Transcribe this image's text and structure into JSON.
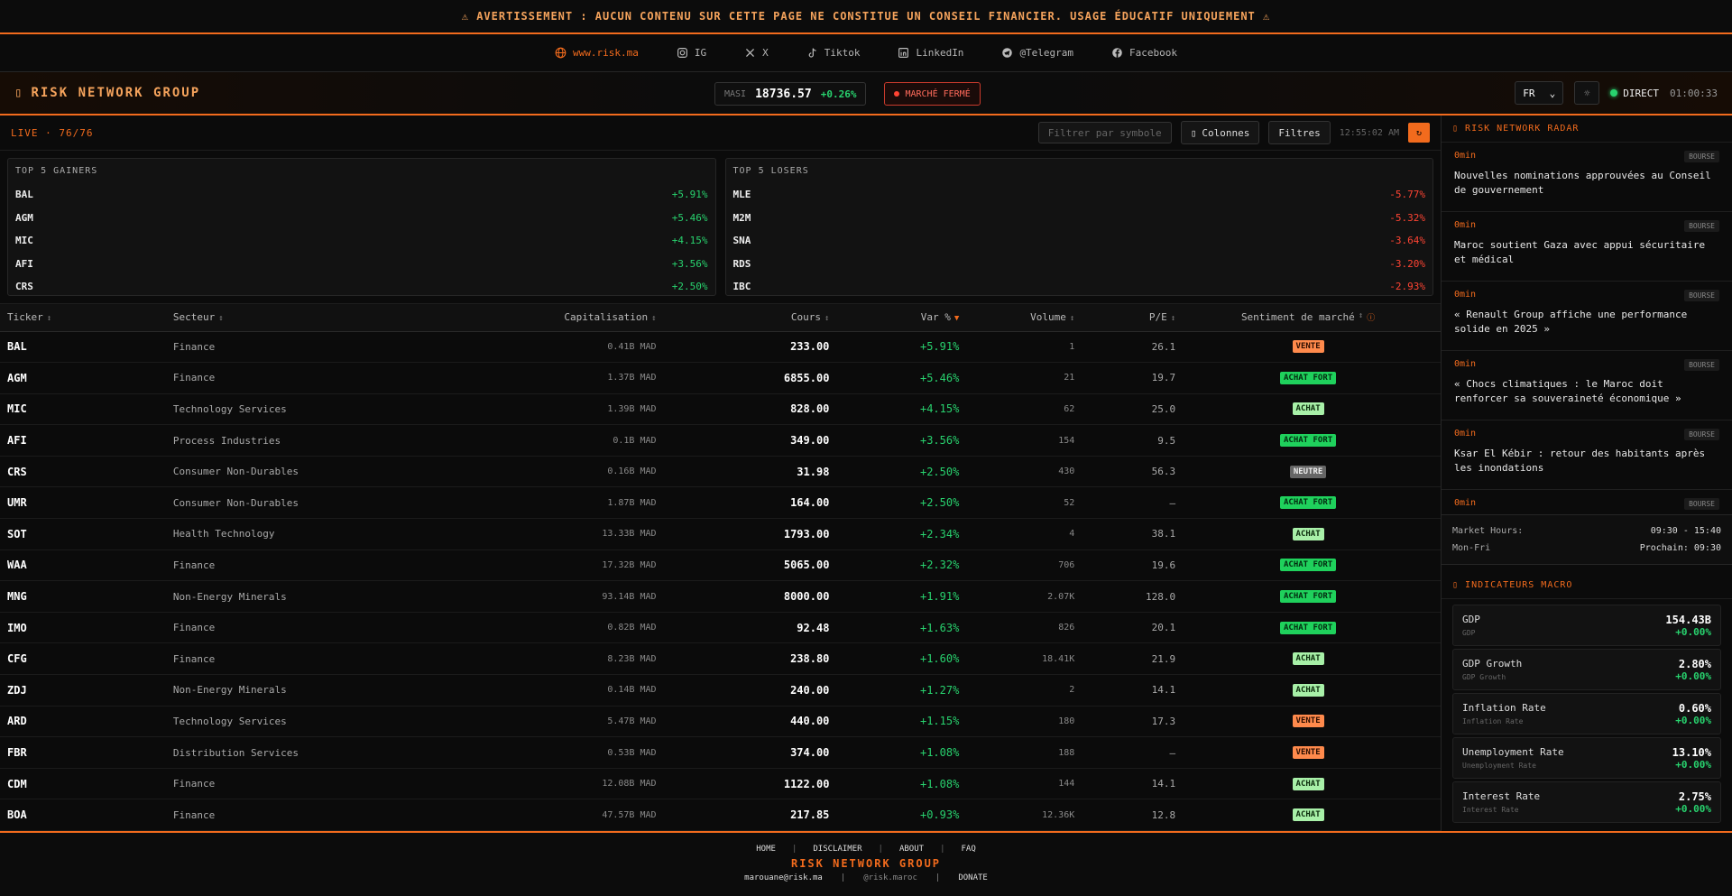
{
  "banner": {
    "text": "⚠ AVERTISSEMENT : AUCUN CONTENU SUR CETTE PAGE NE CONSTITUE UN CONSEIL FINANCIER. USAGE ÉDUCATIF UNIQUEMENT ⚠"
  },
  "social": [
    {
      "label": "www.risk.ma",
      "icon": "globe-icon"
    },
    {
      "label": "IG",
      "icon": "instagram-icon"
    },
    {
      "label": "X",
      "icon": "x-icon"
    },
    {
      "label": "Tiktok",
      "icon": "tiktok-icon"
    },
    {
      "label": "LinkedIn",
      "icon": "linkedin-icon"
    },
    {
      "label": "@Telegram",
      "icon": "telegram-icon"
    },
    {
      "label": "Facebook",
      "icon": "facebook-icon"
    }
  ],
  "header": {
    "brand": "RISK NETWORK GROUP",
    "masi_label": "MASI",
    "masi_value": "18736.57",
    "masi_change": "+0.26%",
    "market_status": "MARCHÉ FERMÉ",
    "language": "FR",
    "live_label": "DIRECT",
    "clock": "01:00:33"
  },
  "toolbar": {
    "live_count": "LIVE · 76/76",
    "filter_placeholder": "Filtrer par symbole",
    "columns_label": "Colonnes",
    "filters_label": "Filtres",
    "time": "12:55:02 AM"
  },
  "gainers": {
    "title": "TOP 5 GAINERS",
    "items": [
      {
        "symbol": "BAL",
        "change": "+5.91%"
      },
      {
        "symbol": "AGM",
        "change": "+5.46%"
      },
      {
        "symbol": "MIC",
        "change": "+4.15%"
      },
      {
        "symbol": "AFI",
        "change": "+3.56%"
      },
      {
        "symbol": "CRS",
        "change": "+2.50%"
      }
    ]
  },
  "losers": {
    "title": "TOP 5 LOSERS",
    "items": [
      {
        "symbol": "MLE",
        "change": "-5.77%"
      },
      {
        "symbol": "M2M",
        "change": "-5.32%"
      },
      {
        "symbol": "SNA",
        "change": "-3.64%"
      },
      {
        "symbol": "RDS",
        "change": "-3.20%"
      },
      {
        "symbol": "IBC",
        "change": "-2.93%"
      }
    ]
  },
  "table": {
    "headers": [
      "Ticker",
      "Secteur",
      "Capitalisation",
      "Cours",
      "Var %",
      "Volume",
      "P/E",
      "Sentiment de marché"
    ],
    "rows": [
      {
        "ticker": "BAL",
        "sector": "Finance",
        "cap": "0.41B MAD",
        "price": "233.00",
        "var": "+5.91%",
        "volume": "1",
        "pe": "26.1",
        "sentiment": "VENTE",
        "s": "vente"
      },
      {
        "ticker": "AGM",
        "sector": "Finance",
        "cap": "1.37B MAD",
        "price": "6855.00",
        "var": "+5.46%",
        "volume": "21",
        "pe": "19.7",
        "sentiment": "ACHAT FORT",
        "s": "achatfort"
      },
      {
        "ticker": "MIC",
        "sector": "Technology Services",
        "cap": "1.39B MAD",
        "price": "828.00",
        "var": "+4.15%",
        "volume": "62",
        "pe": "25.0",
        "sentiment": "ACHAT",
        "s": "achat"
      },
      {
        "ticker": "AFI",
        "sector": "Process Industries",
        "cap": "0.1B MAD",
        "price": "349.00",
        "var": "+3.56%",
        "volume": "154",
        "pe": "9.5",
        "sentiment": "ACHAT FORT",
        "s": "achatfort"
      },
      {
        "ticker": "CRS",
        "sector": "Consumer Non-Durables",
        "cap": "0.16B MAD",
        "price": "31.98",
        "var": "+2.50%",
        "volume": "430",
        "pe": "56.3",
        "sentiment": "NEUTRE",
        "s": "neutre"
      },
      {
        "ticker": "UMR",
        "sector": "Consumer Non-Durables",
        "cap": "1.87B MAD",
        "price": "164.00",
        "var": "+2.50%",
        "volume": "52",
        "pe": "—",
        "sentiment": "ACHAT FORT",
        "s": "achatfort"
      },
      {
        "ticker": "SOT",
        "sector": "Health Technology",
        "cap": "13.33B MAD",
        "price": "1793.00",
        "var": "+2.34%",
        "volume": "4",
        "pe": "38.1",
        "sentiment": "ACHAT",
        "s": "achat"
      },
      {
        "ticker": "WAA",
        "sector": "Finance",
        "cap": "17.32B MAD",
        "price": "5065.00",
        "var": "+2.32%",
        "volume": "706",
        "pe": "19.6",
        "sentiment": "ACHAT FORT",
        "s": "achatfort"
      },
      {
        "ticker": "MNG",
        "sector": "Non-Energy Minerals",
        "cap": "93.14B MAD",
        "price": "8000.00",
        "var": "+1.91%",
        "volume": "2.07K",
        "pe": "128.0",
        "sentiment": "ACHAT FORT",
        "s": "achatfort"
      },
      {
        "ticker": "IMO",
        "sector": "Finance",
        "cap": "0.82B MAD",
        "price": "92.48",
        "var": "+1.63%",
        "volume": "826",
        "pe": "20.1",
        "sentiment": "ACHAT FORT",
        "s": "achatfort"
      },
      {
        "ticker": "CFG",
        "sector": "Finance",
        "cap": "8.23B MAD",
        "price": "238.80",
        "var": "+1.60%",
        "volume": "18.41K",
        "pe": "21.9",
        "sentiment": "ACHAT",
        "s": "achat"
      },
      {
        "ticker": "ZDJ",
        "sector": "Non-Energy Minerals",
        "cap": "0.14B MAD",
        "price": "240.00",
        "var": "+1.27%",
        "volume": "2",
        "pe": "14.1",
        "sentiment": "ACHAT",
        "s": "achat"
      },
      {
        "ticker": "ARD",
        "sector": "Technology Services",
        "cap": "5.47B MAD",
        "price": "440.00",
        "var": "+1.15%",
        "volume": "180",
        "pe": "17.3",
        "sentiment": "VENTE",
        "s": "vente"
      },
      {
        "ticker": "FBR",
        "sector": "Distribution Services",
        "cap": "0.53B MAD",
        "price": "374.00",
        "var": "+1.08%",
        "volume": "188",
        "pe": "—",
        "sentiment": "VENTE",
        "s": "vente"
      },
      {
        "ticker": "CDM",
        "sector": "Finance",
        "cap": "12.08B MAD",
        "price": "1122.00",
        "var": "+1.08%",
        "volume": "144",
        "pe": "14.1",
        "sentiment": "ACHAT",
        "s": "achat"
      },
      {
        "ticker": "BOA",
        "sector": "Finance",
        "cap": "47.57B MAD",
        "price": "217.85",
        "var": "+0.93%",
        "volume": "12.36K",
        "pe": "12.8",
        "sentiment": "ACHAT",
        "s": "achat"
      }
    ]
  },
  "radar": {
    "title": "RISK NETWORK RADAR",
    "items": [
      {
        "time": "0min",
        "tag": "BOURSE",
        "text": "Nouvelles nominations approuvées au Conseil de gouvernement"
      },
      {
        "time": "0min",
        "tag": "BOURSE",
        "text": "Maroc soutient Gaza avec appui sécuritaire et médical"
      },
      {
        "time": "0min",
        "tag": "BOURSE",
        "text": "« Renault Group affiche une performance solide en 2025 »"
      },
      {
        "time": "0min",
        "tag": "BOURSE",
        "text": "« Chocs climatiques : le Maroc doit renforcer sa souveraineté économique »"
      },
      {
        "time": "0min",
        "tag": "BOURSE",
        "text": "Ksar El Kébir : retour des habitants après les inondations"
      },
      {
        "time": "0min",
        "tag": "BOURSE",
        "text": ""
      }
    ]
  },
  "hours": {
    "label1": "Market Hours:",
    "value1": "09:30 - 15:40",
    "label2": "Mon-Fri",
    "value2": "Prochain: 09:30"
  },
  "macro": {
    "title": "INDICATEURS MACRO",
    "items": [
      {
        "name": "GDP",
        "sub": "GDP",
        "value": "154.43B",
        "change": "+0.00%"
      },
      {
        "name": "GDP Growth",
        "sub": "GDP Growth",
        "value": "2.80%",
        "change": "+0.00%"
      },
      {
        "name": "Inflation Rate",
        "sub": "Inflation Rate",
        "value": "0.60%",
        "change": "+0.00%"
      },
      {
        "name": "Unemployment Rate",
        "sub": "Unemployment Rate",
        "value": "13.10%",
        "change": "+0.00%"
      },
      {
        "name": "Interest Rate",
        "sub": "Interest Rate",
        "value": "2.75%",
        "change": "+0.00%"
      }
    ]
  },
  "footer": {
    "nav": [
      "HOME",
      "DISCLAIMER",
      "ABOUT",
      "FAQ"
    ],
    "brand": "RISK NETWORK GROUP",
    "email": "marouane@risk.ma",
    "handle": "@risk.maroc",
    "donate": "DONATE"
  },
  "colors": {
    "accent": "#f26b1d",
    "positive": "#28d26e",
    "negative": "#ff4433"
  }
}
